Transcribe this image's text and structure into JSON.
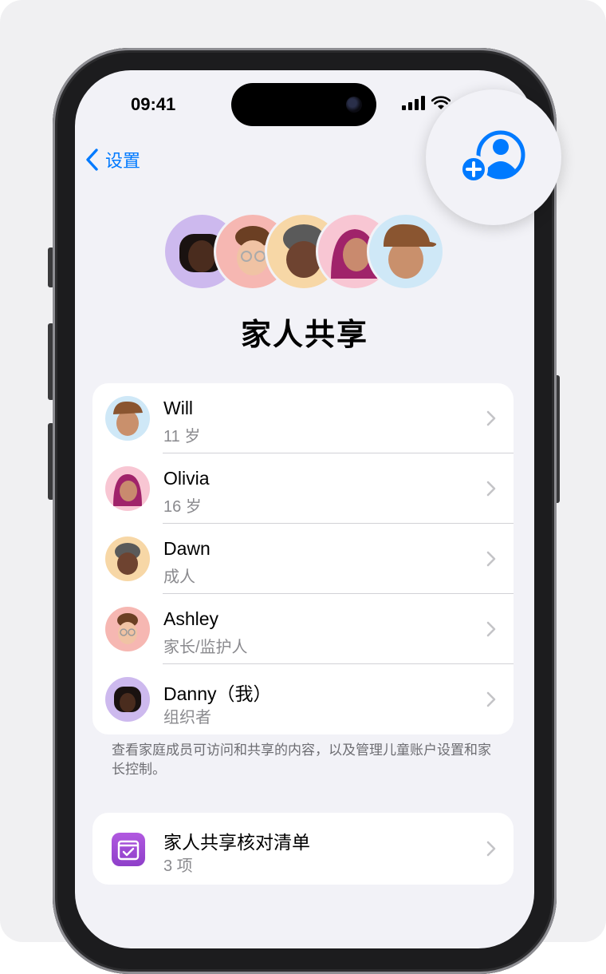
{
  "status_bar": {
    "time": "09:41"
  },
  "nav": {
    "back_label": "设置"
  },
  "page": {
    "title": "家人共享"
  },
  "members": [
    {
      "name": "Will",
      "role": "11 岁",
      "avatar_color": "#cfe8f7"
    },
    {
      "name": "Olivia",
      "role": "16 岁",
      "avatar_color": "#f8c6d3"
    },
    {
      "name": "Dawn",
      "role": "成人",
      "avatar_color": "#f7d7a6"
    },
    {
      "name": "Ashley",
      "role": "家长/监护人",
      "avatar_color": "#f6b7b2"
    },
    {
      "name": "Danny（我）",
      "role": "组织者",
      "avatar_color": "#cdb9ee"
    }
  ],
  "footnote": "查看家庭成员可访问和共享的内容，以及管理儿童账户设置和家长控制。",
  "checklist": {
    "title": "家人共享核对清单",
    "count": "3 项"
  },
  "add_member_button": {
    "icon": "add-person-icon"
  },
  "colors": {
    "accent": "#007aff",
    "checklist_icon": "#a44fd8"
  }
}
